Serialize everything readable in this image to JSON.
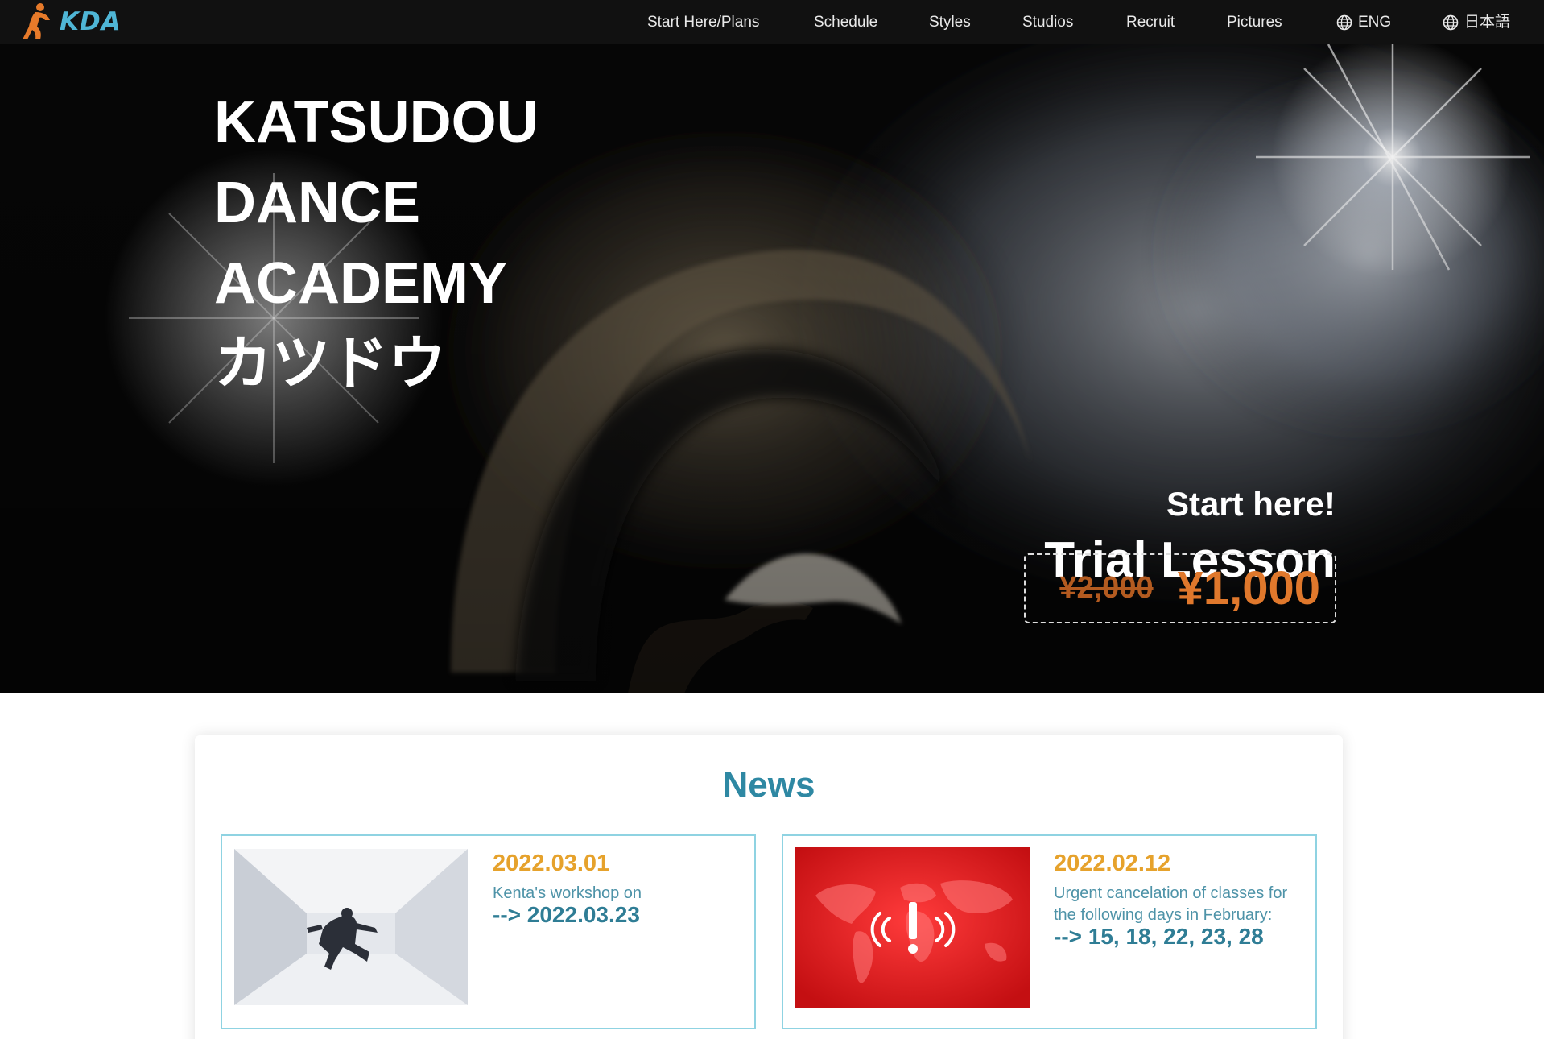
{
  "brand": {
    "logo_text": "KDA",
    "accent": "#4fb6d6",
    "mark_color": "#e67a2a"
  },
  "nav": {
    "items": [
      {
        "label": "Start Here/Plans"
      },
      {
        "label": "Schedule"
      },
      {
        "label": "Styles"
      },
      {
        "label": "Studios"
      },
      {
        "label": "Recruit"
      },
      {
        "label": "Pictures"
      }
    ],
    "lang_en": "ENG",
    "lang_ja": "日本語",
    "lang_icon": "globe-icon"
  },
  "hero": {
    "title_lines": [
      "KATSUDOU",
      "DANCE",
      "ACADEMY",
      "カツドウ"
    ],
    "start_here": "Start here!",
    "trial": "Trial Lesson",
    "old_price": "¥2,000",
    "new_price": "¥1,000",
    "price_color": "#e0782c"
  },
  "news": {
    "title": "News",
    "items": [
      {
        "date": "2022.03.01",
        "desc": "Kenta's workshop on",
        "highlight": "--> 2022.03.23",
        "image": "dancer-photo"
      },
      {
        "date": "2022.02.12",
        "desc": "Urgent cancelation of classes for the following days in February:",
        "highlight": "--> 15, 18, 22, 23, 28",
        "image": "alert-map-graphic"
      }
    ]
  }
}
